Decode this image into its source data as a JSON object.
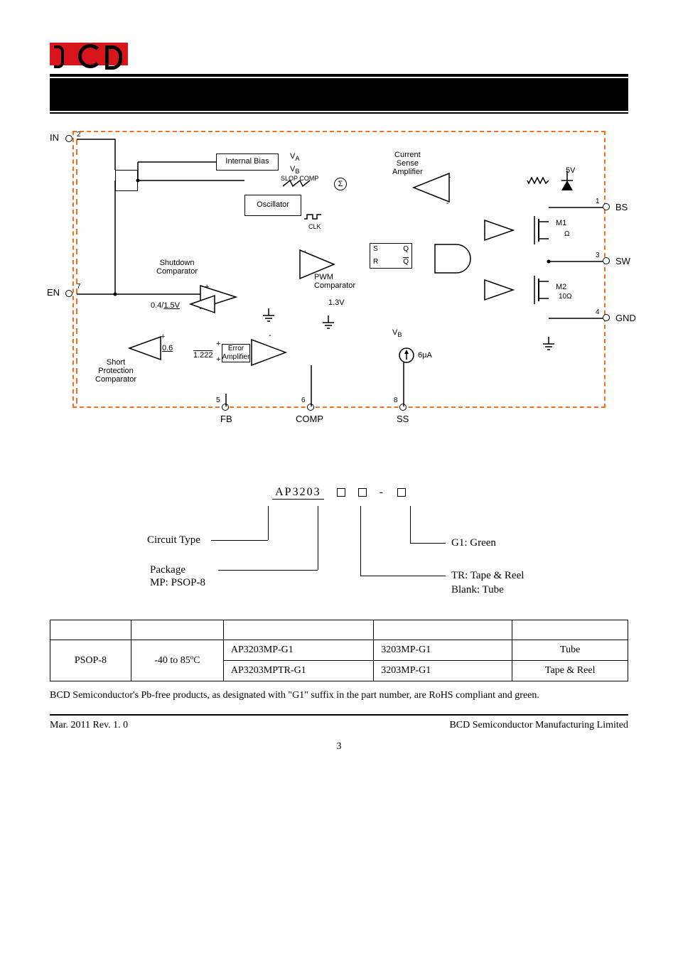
{
  "diagram": {
    "pins": {
      "in": "IN",
      "in_num": "2",
      "en": "EN",
      "en_num": "7",
      "bs": "BS",
      "bs_num": "1",
      "sw": "SW",
      "sw_num": "3",
      "gnd": "GND",
      "gnd_num": "4",
      "fb": "FB",
      "fb_num": "5",
      "comp": "COMP",
      "comp_num": "6",
      "ss": "SS",
      "ss_num": "8"
    },
    "blocks": {
      "internal_bias": "Internal Bias",
      "oscillator": "Oscillator",
      "shutdown": "Shutdown\nComparator",
      "short_prot": "Short\nProtection\nComparator",
      "error_amp": "Error\nAmplifier",
      "pwm": "PWM\nComparator",
      "current_sense": "Current\nSense\nAmplifier"
    },
    "labels": {
      "va": "V",
      "va_sub": "A",
      "vb": "V",
      "vb_sub": "B",
      "slop": "SLOP COMP",
      "clk": "CLK",
      "sigma": "Σ",
      "s": "S",
      "q": "Q",
      "r": "R",
      "qbar": "Q",
      "v0_4": "0.4/",
      "v1_5": "1.5V",
      "v0_6": "0.6",
      "v1_222": "1.222",
      "v1_3": "1.3V",
      "vb2": "V",
      "vb2_sub": "B",
      "i6u": "6μA",
      "v5": "5V",
      "m1": "M1",
      "m1_ohm": "Ω",
      "m2": "M2",
      "m2_ohm": "10Ω",
      "plus": "+",
      "minus": "-"
    }
  },
  "ordering": {
    "prefix": "AP3203",
    "circuit_type": "Circuit Type",
    "package_label": "Package",
    "package_val": "MP: PSOP-8",
    "g1": "G1: Green",
    "tr": "TR: Tape & Reel",
    "blank": "Blank: Tube"
  },
  "table": {
    "rows": [
      {
        "pkg": "PSOP-8",
        "temp": "-40 to 85ºC",
        "part1": "AP3203MP-G1",
        "mark1": "3203MP-G1",
        "ship1": "Tube",
        "part2": "AP3203MPTR-G1",
        "mark2": "3203MP-G1",
        "ship2": "Tape & Reel"
      }
    ]
  },
  "note": "BCD Semiconductor's Pb-free products, as designated with \"G1\" suffix in the part number, are RoHS compliant and green.",
  "footer": {
    "left": "Mar. 2011    Rev. 1. 0",
    "right": "BCD Semiconductor Manufacturing Limited",
    "page": "3"
  }
}
